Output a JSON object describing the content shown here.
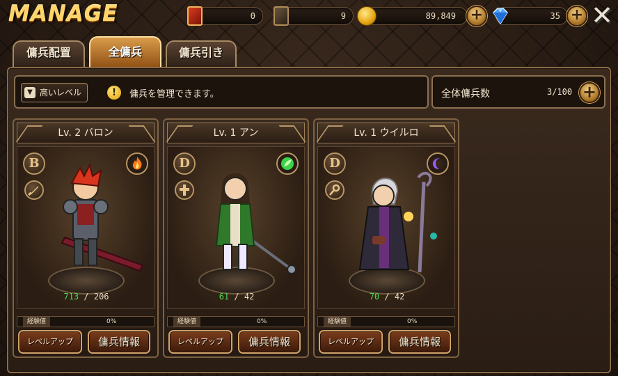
{
  "header": {
    "title": "MANAGE",
    "resources": [
      {
        "name": "summon-book-red",
        "value": "0"
      },
      {
        "name": "summon-book-dark",
        "value": "9"
      },
      {
        "name": "gold",
        "value": "89,849"
      },
      {
        "name": "crystal",
        "value": "35"
      }
    ],
    "plus_label": "+",
    "close_label": "✕"
  },
  "tabs": [
    {
      "label": "傭兵配置",
      "active": false
    },
    {
      "label": "全傭兵",
      "active": true
    },
    {
      "label": "傭兵引き",
      "active": false
    }
  ],
  "toolbar": {
    "sort_label": "高いレベル",
    "notice": "傭兵を管理できます。",
    "count_label": "全体傭兵数",
    "count_value": "3/100"
  },
  "mercenaries": [
    {
      "name": "Lv. 2 バロン",
      "rank": "B",
      "role_icon": "sword-icon",
      "element_icon": "fire-icon",
      "hp_current": "713",
      "hp_sep": " / ",
      "hp_max": "206",
      "exp_label": "経験値",
      "exp_value": "0%",
      "level_up_label": "レベルアップ",
      "info_label": "傭兵情報"
    },
    {
      "name": "Lv. 1 アン",
      "rank": "D",
      "role_icon": "cross-icon",
      "element_icon": "leaf-icon",
      "hp_current": "61",
      "hp_sep": " / ",
      "hp_max": "42",
      "exp_label": "経験値",
      "exp_value": "0%",
      "level_up_label": "レベルアップ",
      "info_label": "傭兵情報"
    },
    {
      "name": "Lv. 1 ウイルロ",
      "rank": "D",
      "role_icon": "magic-staff-icon",
      "element_icon": "moon-icon",
      "hp_current": "70",
      "hp_sep": " / ",
      "hp_max": "42",
      "exp_label": "経験値",
      "exp_value": "0%",
      "level_up_label": "レベルアップ",
      "info_label": "傭兵情報"
    }
  ],
  "colors": {
    "accent_gold": "#ffd56b",
    "hp_green": "#4fd94f",
    "fire": "#ff7a1a",
    "leaf": "#3cd24a",
    "moon": "#9b5cff"
  }
}
